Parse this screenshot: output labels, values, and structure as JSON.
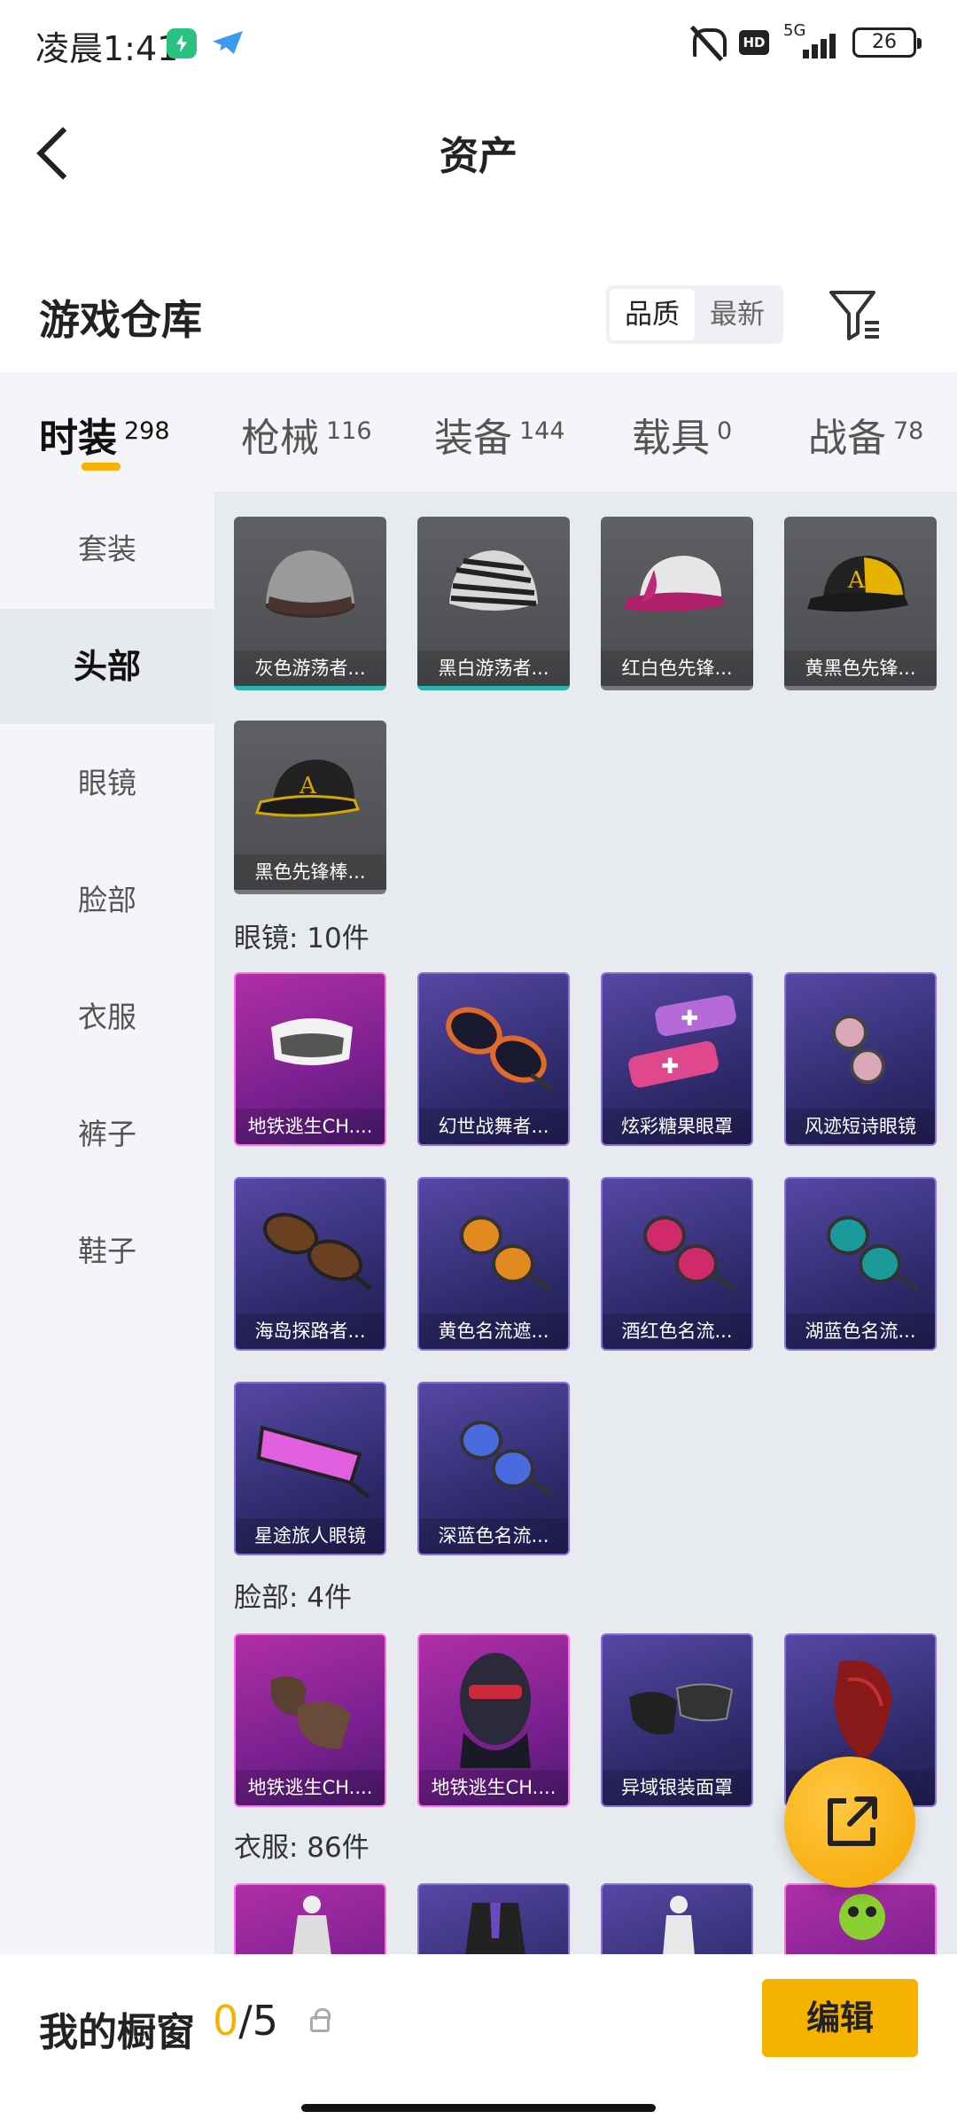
{
  "status_bar": {
    "time": "凌晨1:41",
    "hd": "HD",
    "network": "5G",
    "battery": "26"
  },
  "header": {
    "title": "资产"
  },
  "warehouse": {
    "title": "游戏仓库",
    "sort_options": [
      "品质",
      "最新"
    ],
    "sort_selected": "品质"
  },
  "tabs": [
    {
      "name": "时装",
      "count": "298",
      "active": true
    },
    {
      "name": "枪械",
      "count": "116"
    },
    {
      "name": "装备",
      "count": "144"
    },
    {
      "name": "载具",
      "count": "0"
    },
    {
      "name": "战备",
      "count": "78"
    }
  ],
  "sidebar": {
    "items": [
      {
        "label": "套装"
      },
      {
        "label": "头部",
        "active": true
      },
      {
        "label": "眼镜"
      },
      {
        "label": "脸部"
      },
      {
        "label": "衣服"
      },
      {
        "label": "裤子"
      },
      {
        "label": "鞋子"
      }
    ]
  },
  "content": {
    "head_items": [
      {
        "name": "灰色游荡者...",
        "rarity": "gray-teal"
      },
      {
        "name": "黑白游荡者...",
        "rarity": "gray-teal"
      },
      {
        "name": "红白色先锋...",
        "rarity": "gray"
      },
      {
        "name": "黄黑色先锋...",
        "rarity": "gray"
      },
      {
        "name": "黑色先锋棒...",
        "rarity": "gray"
      }
    ],
    "glasses_label": "眼镜: 10件",
    "glasses_items": [
      {
        "name": "地铁逃生CH....",
        "rarity": "pink"
      },
      {
        "name": "幻世战舞者...",
        "rarity": "purple"
      },
      {
        "name": "炫彩糖果眼罩",
        "rarity": "purple"
      },
      {
        "name": "风迹短诗眼镜",
        "rarity": "purple"
      },
      {
        "name": "海岛探路者...",
        "rarity": "purple"
      },
      {
        "name": "黄色名流遮...",
        "rarity": "purple"
      },
      {
        "name": "酒红色名流...",
        "rarity": "purple"
      },
      {
        "name": "湖蓝色名流...",
        "rarity": "purple"
      },
      {
        "name": "星途旅人眼镜",
        "rarity": "purple"
      },
      {
        "name": "深蓝色名流...",
        "rarity": "purple"
      }
    ],
    "face_label": "脸部: 4件",
    "face_items": [
      {
        "name": "地铁逃生CH....",
        "rarity": "pink"
      },
      {
        "name": "地铁逃生CH....",
        "rarity": "pink"
      },
      {
        "name": "异域银装面罩",
        "rarity": "purple"
      },
      {
        "name": "具",
        "rarity": "purple"
      }
    ],
    "clothes_label": "衣服: 86件"
  },
  "showcase": {
    "title": "我的橱窗",
    "current": "0",
    "total": "/5",
    "edit_label": "编辑"
  },
  "colors": {
    "accent": "#f5b300",
    "sidebar_bg": "#f3f5f8",
    "content_bg": "#e7eaef",
    "purple_card": "#3a3280",
    "pink_card": "#9a2a9c"
  }
}
